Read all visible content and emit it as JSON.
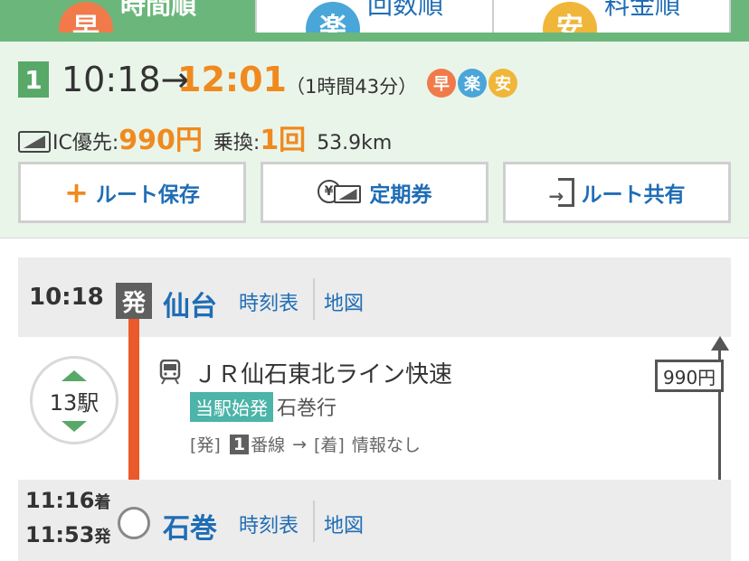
{
  "tabs": [
    {
      "icon": "早",
      "label": "時間順",
      "color": "#f07a4a",
      "active": true
    },
    {
      "icon": "楽",
      "label": "回数順",
      "color": "#4aa6d8",
      "active": false
    },
    {
      "icon": "安",
      "label": "料金順",
      "color": "#f0b63a",
      "active": false
    }
  ],
  "summary": {
    "route_number": "1",
    "depart": "10:18→",
    "arrive": "12:01",
    "duration": "（1時間43分）",
    "badges": [
      {
        "icon": "早",
        "color": "#f07a4a"
      },
      {
        "icon": "楽",
        "color": "#4aa6d8"
      },
      {
        "icon": "安",
        "color": "#f0b63a"
      }
    ],
    "ic_label": "IC優先:",
    "fare": "990円",
    "transfer_label": "乗換:",
    "transfer_count": "1回",
    "distance": "53.9km"
  },
  "actions": {
    "save": "ルート保存",
    "pass": "定期券",
    "share": "ルート共有",
    "yen_glyph": "¥"
  },
  "route": {
    "origin": {
      "time": "10:18",
      "badge": "発",
      "name": "仙台",
      "timetable": "時刻表",
      "map": "地図"
    },
    "segment": {
      "stops": "13駅",
      "train": "ＪＲ仙石東北ライン快速",
      "origin_badge": "当駅始発",
      "destination": "石巻行",
      "dep_bracket": "[発]",
      "platform": "1",
      "platform_suffix": "番線",
      "arrow": "→",
      "arr_bracket": "[着]",
      "arr_info": "情報なし",
      "fare": "990円"
    },
    "stop": {
      "arrive_time": "11:16",
      "arrive_suffix": "着",
      "depart_time": "11:53",
      "depart_suffix": "発",
      "name": "石巻",
      "timetable": "時刻表",
      "map": "地図"
    }
  },
  "colors": {
    "accent_green": "#6bb77b",
    "orange": "#f08a1e",
    "link_blue": "#1f6db5",
    "rail_red": "#ea5a2a"
  }
}
